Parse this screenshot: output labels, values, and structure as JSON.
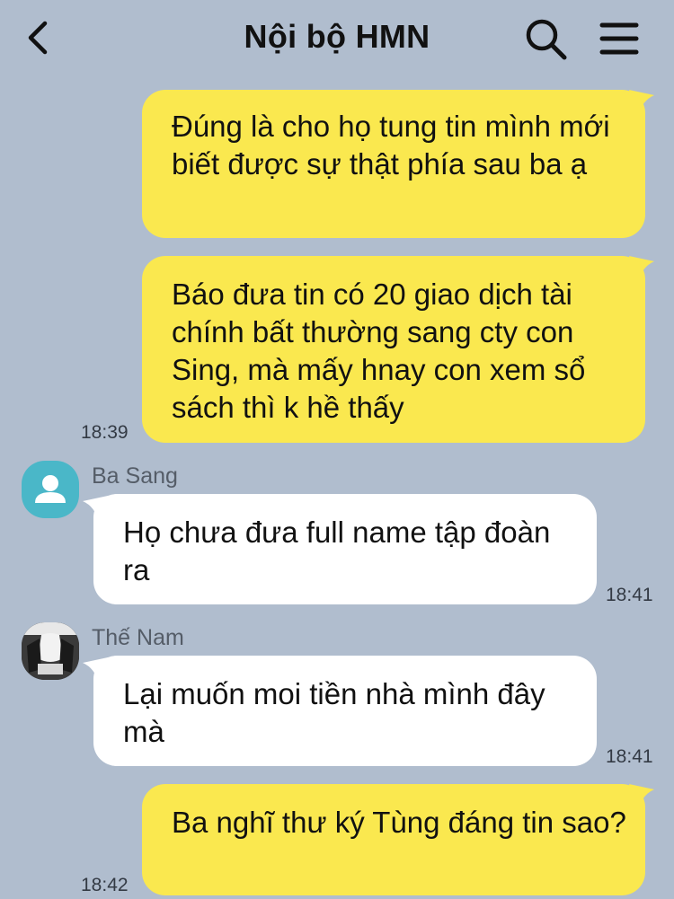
{
  "header": {
    "title": "Nội bộ HMN"
  },
  "colors": {
    "background": "#b0bdce",
    "outgoing_bubble": "#fae84f",
    "incoming_bubble": "#ffffff",
    "avatar_default": "#4ab7c8"
  },
  "messages": [
    {
      "direction": "outgoing",
      "text": "Đúng là cho họ tung tin mình mới biết được sự thật phía sau ba ạ",
      "time": ""
    },
    {
      "direction": "outgoing",
      "text": "Báo đưa tin có 20 giao dịch tài chính bất thường sang cty con Sing, mà mấy hnay con xem sổ sách thì k hề thấy",
      "time": "18:39"
    },
    {
      "direction": "incoming",
      "sender": "Ba Sang",
      "text": "Họ chưa đưa full name tập đoàn ra",
      "time": "18:41"
    },
    {
      "direction": "incoming",
      "sender": "Thế Nam",
      "text": "Lại muốn moi tiền nhà mình đây mà",
      "time": "18:41"
    },
    {
      "direction": "outgoing",
      "text": "Ba nghĩ thư ký Tùng đáng tin sao?",
      "time": "18:42"
    }
  ]
}
